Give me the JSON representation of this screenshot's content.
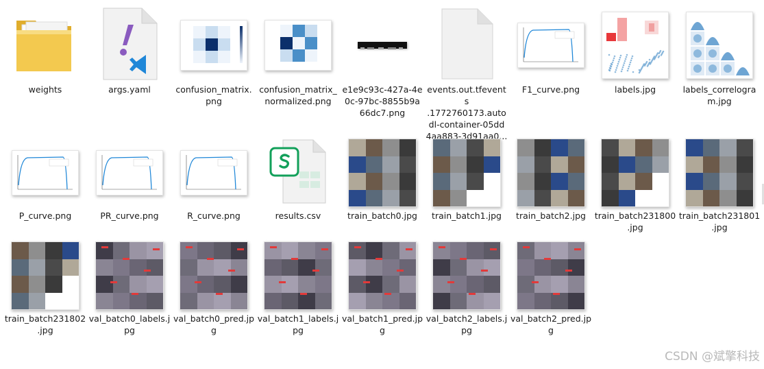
{
  "files": [
    {
      "id": "weights",
      "label": "weights",
      "kind": "folder"
    },
    {
      "id": "args",
      "label": "args.yaml",
      "kind": "yaml"
    },
    {
      "id": "cm",
      "label": "confusion_matrix.png",
      "kind": "cm"
    },
    {
      "id": "cmn",
      "label": "confusion_matrix_normalized.png",
      "kind": "cmn"
    },
    {
      "id": "eid",
      "label": "e1e9c93c-427a-4e0c-97bc-8855b9a66dc7.png",
      "kind": "strip"
    },
    {
      "id": "events",
      "label": "events.out.tfevents.1772760173.autodl-container-05dd4aa883-3d91aa0...",
      "kind": "blank"
    },
    {
      "id": "f1",
      "label": "F1_curve.png",
      "kind": "curve"
    },
    {
      "id": "labels",
      "label": "labels.jpg",
      "kind": "labels"
    },
    {
      "id": "labcor",
      "label": "labels_correlogram.jpg",
      "kind": "correlogram"
    },
    {
      "id": "p",
      "label": "P_curve.png",
      "kind": "curve"
    },
    {
      "id": "pr",
      "label": "PR_curve.png",
      "kind": "curve"
    },
    {
      "id": "r",
      "label": "R_curve.png",
      "kind": "curve"
    },
    {
      "id": "res",
      "label": "results.csv",
      "kind": "csv"
    },
    {
      "id": "tb0",
      "label": "train_batch0.jpg",
      "kind": "mosaic"
    },
    {
      "id": "tb1",
      "label": "train_batch1.jpg",
      "kind": "mosaic"
    },
    {
      "id": "tb2",
      "label": "train_batch2.jpg",
      "kind": "mosaic"
    },
    {
      "id": "tb231800",
      "label": "train_batch231800.jpg",
      "kind": "mosaic"
    },
    {
      "id": "tb231801",
      "label": "train_batch231801.jpg",
      "kind": "mosaic"
    },
    {
      "id": "tb231802",
      "label": "train_batch231802.jpg",
      "kind": "mosaic"
    },
    {
      "id": "vb0l",
      "label": "val_batch0_labels.jpg",
      "kind": "valmosaic"
    },
    {
      "id": "vb0p",
      "label": "val_batch0_pred.jpg",
      "kind": "valmosaic"
    },
    {
      "id": "vb1l",
      "label": "val_batch1_labels.jpg",
      "kind": "valmosaic"
    },
    {
      "id": "vb1p",
      "label": "val_batch1_pred.jpg",
      "kind": "valmosaic"
    },
    {
      "id": "vb2l",
      "label": "val_batch2_labels.jpg",
      "kind": "valmosaic"
    },
    {
      "id": "vb2p",
      "label": "val_batch2_pred.jpg",
      "kind": "valmosaic"
    }
  ],
  "labels_display": {
    "weights": [
      "weights"
    ],
    "args": [
      "args.yaml"
    ],
    "cm": [
      "confusion_matrix.",
      "png"
    ],
    "cmn": [
      "confusion_matrix_",
      "normalized.png"
    ],
    "eid": [
      "e1e9c93c-427a-4e",
      "0c-97bc-8855b9a",
      "66dc7.png"
    ],
    "events": [
      "events.out.tfevents",
      ".1772760173.auto",
      "dl-container-05dd",
      "4aa883-3d91aa0..."
    ],
    "f1": [
      "F1_curve.png"
    ],
    "labels": [
      "labels.jpg"
    ],
    "labcor": [
      "labels_correlogra",
      "m.jpg"
    ],
    "p": [
      "P_curve.png"
    ],
    "pr": [
      "PR_curve.png"
    ],
    "r": [
      "R_curve.png"
    ],
    "res": [
      "results.csv"
    ],
    "tb0": [
      "train_batch0.jpg"
    ],
    "tb1": [
      "train_batch1.jpg"
    ],
    "tb2": [
      "train_batch2.jpg"
    ],
    "tb231800": [
      "train_batch231800",
      ".jpg"
    ],
    "tb231801": [
      "train_batch231801",
      ".jpg"
    ],
    "tb231802": [
      "train_batch231802",
      ".jpg"
    ],
    "vb0l": [
      "val_batch0_labels.j",
      "pg"
    ],
    "vb0p": [
      "val_batch0_pred.jp",
      "g"
    ],
    "vb1l": [
      "val_batch1_labels.j",
      "pg"
    ],
    "vb1p": [
      "val_batch1_pred.jp",
      "g"
    ],
    "vb2l": [
      "val_batch2_labels.j",
      "pg"
    ],
    "vb2p": [
      "val_batch2_pred.jp",
      "g"
    ]
  },
  "icons": {
    "folder": "folder-icon",
    "yaml": "yaml-file-icon",
    "csv": "excel-csv-icon",
    "blank": "blank-file-icon"
  },
  "colors": {
    "folder": "#f3c94f",
    "folder_dark": "#e0ad2c",
    "vscode": "#1f87d8",
    "yaml_mark": "#8a5bbf",
    "excel": "#12a05a",
    "cm_dark": "#0b2f6b",
    "cm_mid": "#4a8fc8",
    "cm_light": "#c9ddf0"
  },
  "watermark": "CSDN @斌擎科技"
}
